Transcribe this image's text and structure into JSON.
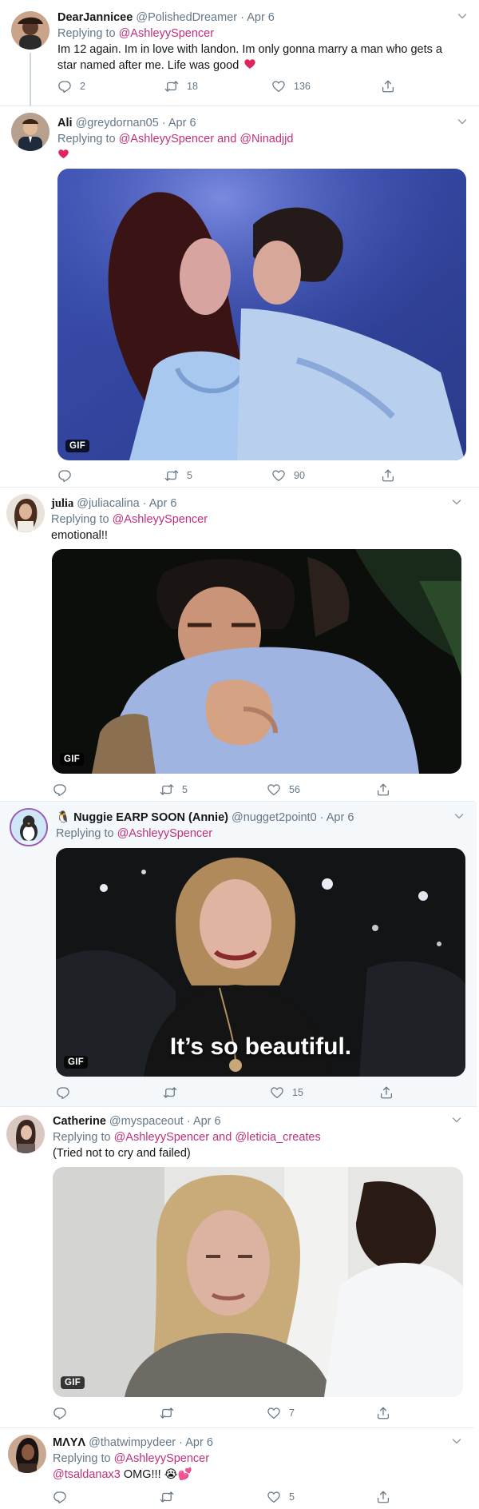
{
  "colors": {
    "accent": "#c0307a",
    "muted": "#657786",
    "text": "#14171a",
    "border": "#e6ecf0",
    "heart": "#e0245e"
  },
  "tweets": [
    {
      "name": "DearJannicee",
      "handle": "@PolishedDreamer",
      "time": "Apr 6",
      "reply_prefix": "Replying to",
      "reply_to": "@AshleyySpencer",
      "text": "Im 12 again. Im in love with landon. Im only gonna marry a man who gets a star named after me. Life was good",
      "emoji": "heart-icon",
      "replies": "2",
      "retweets": "18",
      "likes": "136"
    },
    {
      "name": "Ali",
      "handle": "@greydornan05",
      "time": "Apr 6",
      "reply_prefix": "Replying to",
      "reply_to": "@AshleyySpencer and @Ninadjjd",
      "emoji": "heart-icon",
      "gif_label": "GIF",
      "replies": "",
      "retweets": "5",
      "likes": "90"
    },
    {
      "name": "julia",
      "handle": "@juliacalina",
      "time": "Apr 6",
      "reply_prefix": "Replying to",
      "reply_to": "@AshleyySpencer",
      "text": "emotional!!",
      "gif_label": "GIF",
      "replies": "",
      "retweets": "5",
      "likes": "56"
    },
    {
      "name": "🐧 Nuggie EARP SOON (Annie)",
      "handle": "@nugget2point0",
      "time": "Apr 6",
      "reply_prefix": "Replying to",
      "reply_to": "@AshleyySpencer",
      "gif_label": "GIF",
      "caption": "It’s so beautiful.",
      "replies": "",
      "retweets": "",
      "likes": "15"
    },
    {
      "name": "Catherine",
      "handle": "@myspaceout",
      "time": "Apr 6",
      "reply_prefix": "Replying to",
      "reply_to": "@AshleyySpencer and @leticia_creates",
      "text": "(Tried not to cry and failed)",
      "gif_label": "GIF",
      "replies": "",
      "retweets": "",
      "likes": "7"
    },
    {
      "name": "MΛYΛ",
      "handle": "@thatwimpydeer",
      "time": "Apr 6",
      "reply_prefix": "Replying to",
      "reply_to": "@AshleyySpencer",
      "text_mention": "@tsaldanax3",
      "text": " OMG!!! 😭💕",
      "replies": "",
      "retweets": "",
      "likes": "5"
    }
  ],
  "separator": "·"
}
